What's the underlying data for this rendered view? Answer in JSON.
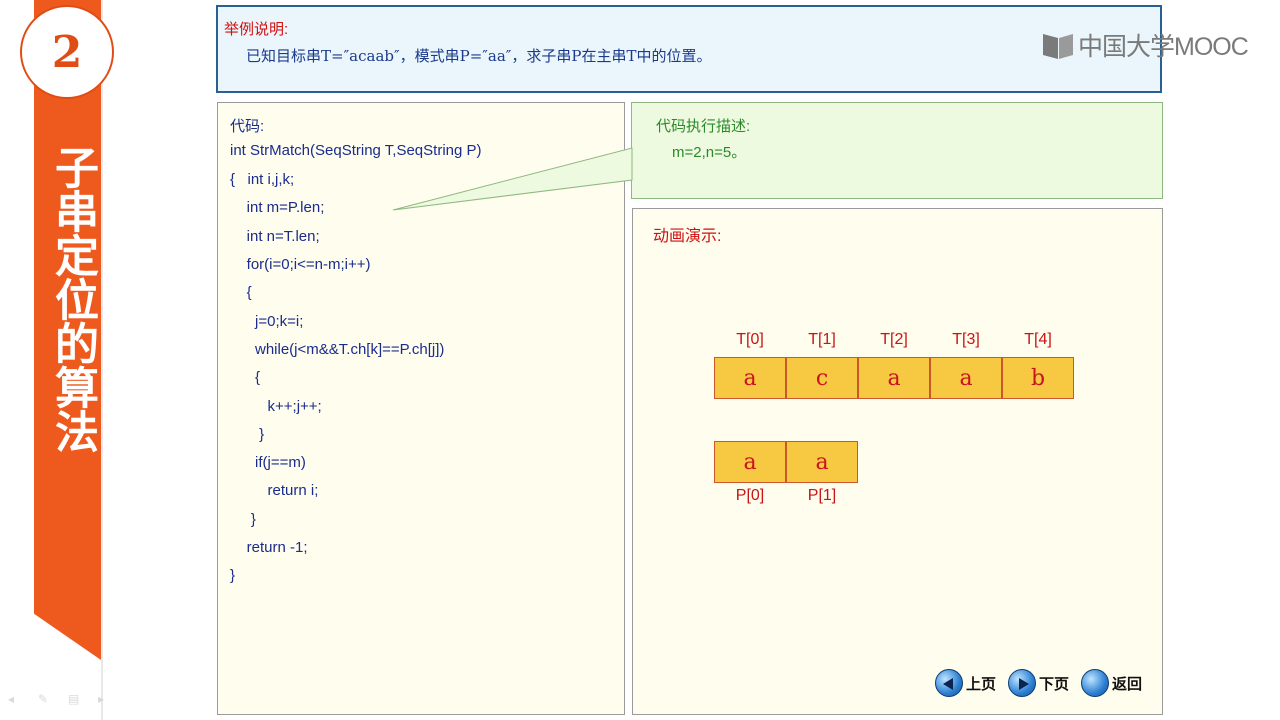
{
  "section": {
    "number": "2",
    "title": "子串定位的算法"
  },
  "example": {
    "title": "举例说明:",
    "text": "已知目标串T=″acaab″，模式串P=″aa″，求子串P在主串T中的位置。"
  },
  "logo": {
    "text": "中国大学MOOC"
  },
  "code": {
    "lines": [
      "代码:",
      "int StrMatch(SeqString T,SeqString P)",
      "{   int i,j,k;",
      "    int m=P.len;",
      "    int n=T.len;",
      "    for(i=0;i<=n-m;i++)",
      "    {",
      "      j=0;k=i;",
      "      while(j<m&&T.ch[k]==P.ch[j])",
      "      {",
      "         k++;j++;",
      "       }",
      "      if(j==m)",
      "         return i;",
      "     }",
      "    return -1;",
      "}"
    ]
  },
  "description": {
    "title": "代码执行描述:",
    "text": "m=2,n=5。"
  },
  "animation": {
    "title": "动画演示:",
    "target": {
      "labels": [
        "T[0]",
        "T[1]",
        "T[2]",
        "T[3]",
        "T[4]"
      ],
      "values": [
        "a",
        "c",
        "a",
        "a",
        "b"
      ]
    },
    "pattern": {
      "labels": [
        "P[0]",
        "P[1]"
      ],
      "values": [
        "a",
        "a"
      ]
    }
  },
  "nav": {
    "prev": "上页",
    "next": "下页",
    "back": "返回"
  },
  "colors": {
    "accent": "#ee5a1e",
    "cell": "#f7c842",
    "cell_border": "#c9582a"
  }
}
